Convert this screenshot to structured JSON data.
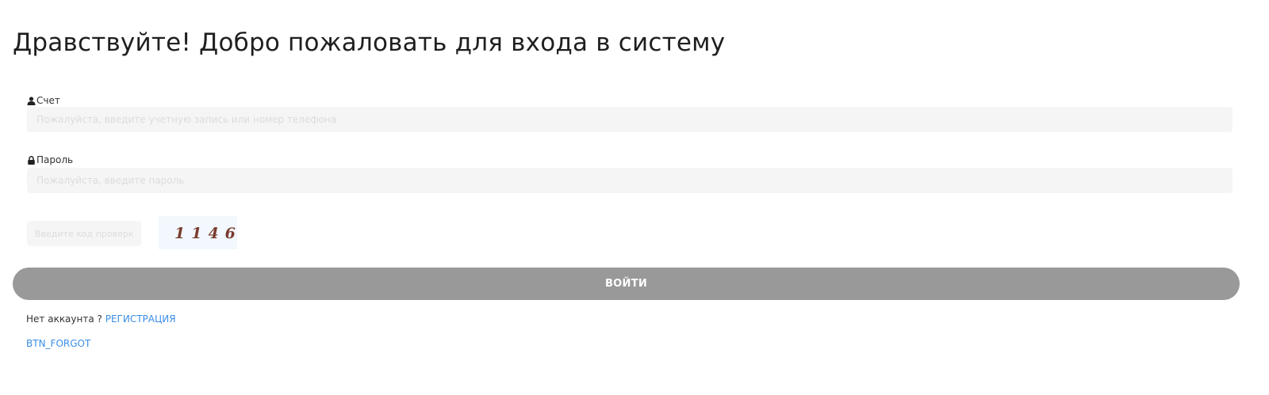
{
  "title": "Дравствуйте!  Добро пожаловать для входа в систему",
  "account": {
    "label": "Счет",
    "icon": "user-icon",
    "placeholder": "Пожалуйста, введите учетную запись или номер телефона"
  },
  "password": {
    "label": "Пароль",
    "icon": "lock-icon",
    "placeholder": "Пожалуйста, введите пароль"
  },
  "captcha": {
    "placeholder": "Введите код проверки",
    "code": "1146",
    "code_color": "#7a3b2e",
    "background": "#f2f8fd"
  },
  "login_button": {
    "label": "ВОЙТИ",
    "color": "#999999"
  },
  "register": {
    "prompt": "Нет аккаунта ? ",
    "link_label": "РЕГИСТРАЦИЯ"
  },
  "forgot": {
    "link_label": "BTN_FORGOT"
  },
  "colors": {
    "link": "#3a8ee6",
    "input_bg": "#f5f5f5"
  }
}
